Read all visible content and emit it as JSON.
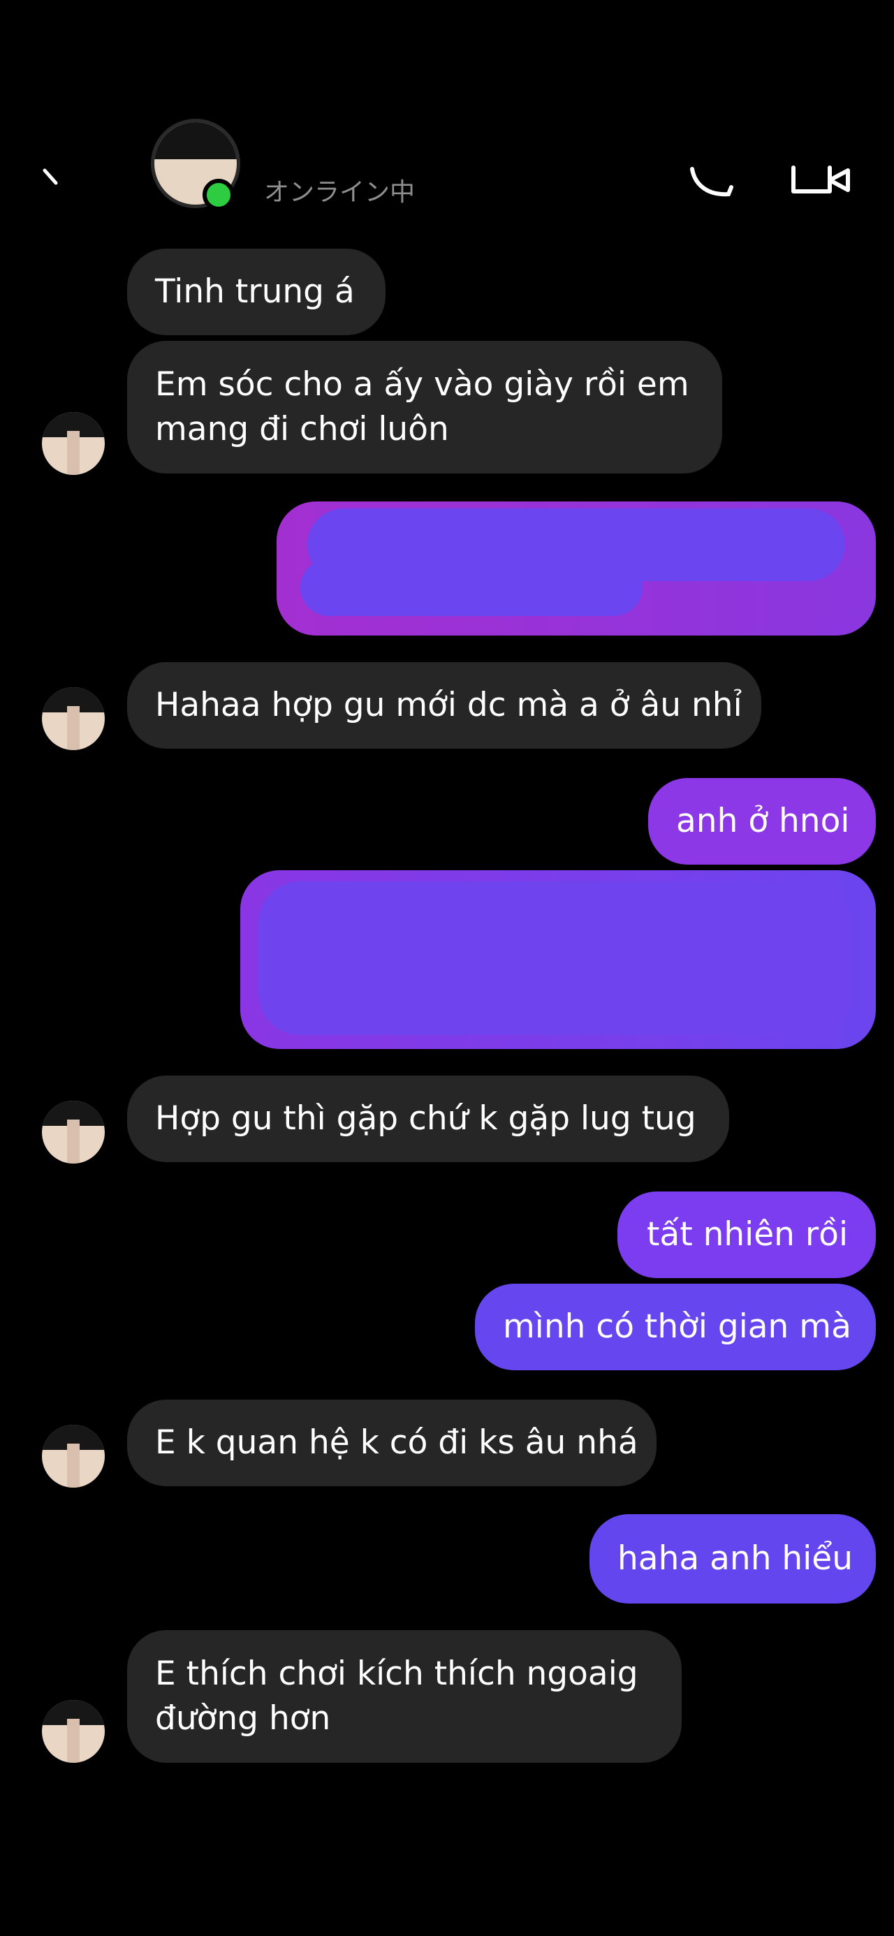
{
  "header": {
    "status": "オンライン中"
  },
  "colors": {
    "background": "#000000",
    "incoming_bubble": "#262626",
    "outgoing_bubble_top": "#9a36d8",
    "outgoing_bubble_bottom": "#6a44f0",
    "online_indicator": "#2ecc40",
    "status_text": "#8e8e8e"
  },
  "icons": {
    "back": "chevron-left-icon",
    "call": "phone-icon",
    "video": "video-camera-icon"
  },
  "messages": [
    {
      "side": "incoming",
      "text": "Tinh trung á"
    },
    {
      "side": "incoming",
      "lines": [
        "Em sóc cho a ấy vào giày rồi em",
        "mang đi chơi luôn"
      ]
    },
    {
      "side": "outgoing",
      "text": "",
      "redacted": true
    },
    {
      "side": "incoming",
      "text": "Hahaa hợp gu mới dc mà a ở âu nhỉ"
    },
    {
      "side": "outgoing",
      "text": "anh ở hnoi"
    },
    {
      "side": "outgoing",
      "text": "",
      "redacted": true
    },
    {
      "side": "incoming",
      "text": "Hợp gu thì gặp chứ k gặp lug tug"
    },
    {
      "side": "outgoing",
      "text": "tất nhiên rồi"
    },
    {
      "side": "outgoing",
      "text": "mình có thời gian mà"
    },
    {
      "side": "incoming",
      "text": "E k quan hệ k có đi ks âu nhá"
    },
    {
      "side": "outgoing",
      "text": "haha anh hiểu"
    },
    {
      "side": "incoming",
      "lines": [
        "E thích chơi kích thích ngoaig",
        "đường hơn"
      ]
    }
  ]
}
